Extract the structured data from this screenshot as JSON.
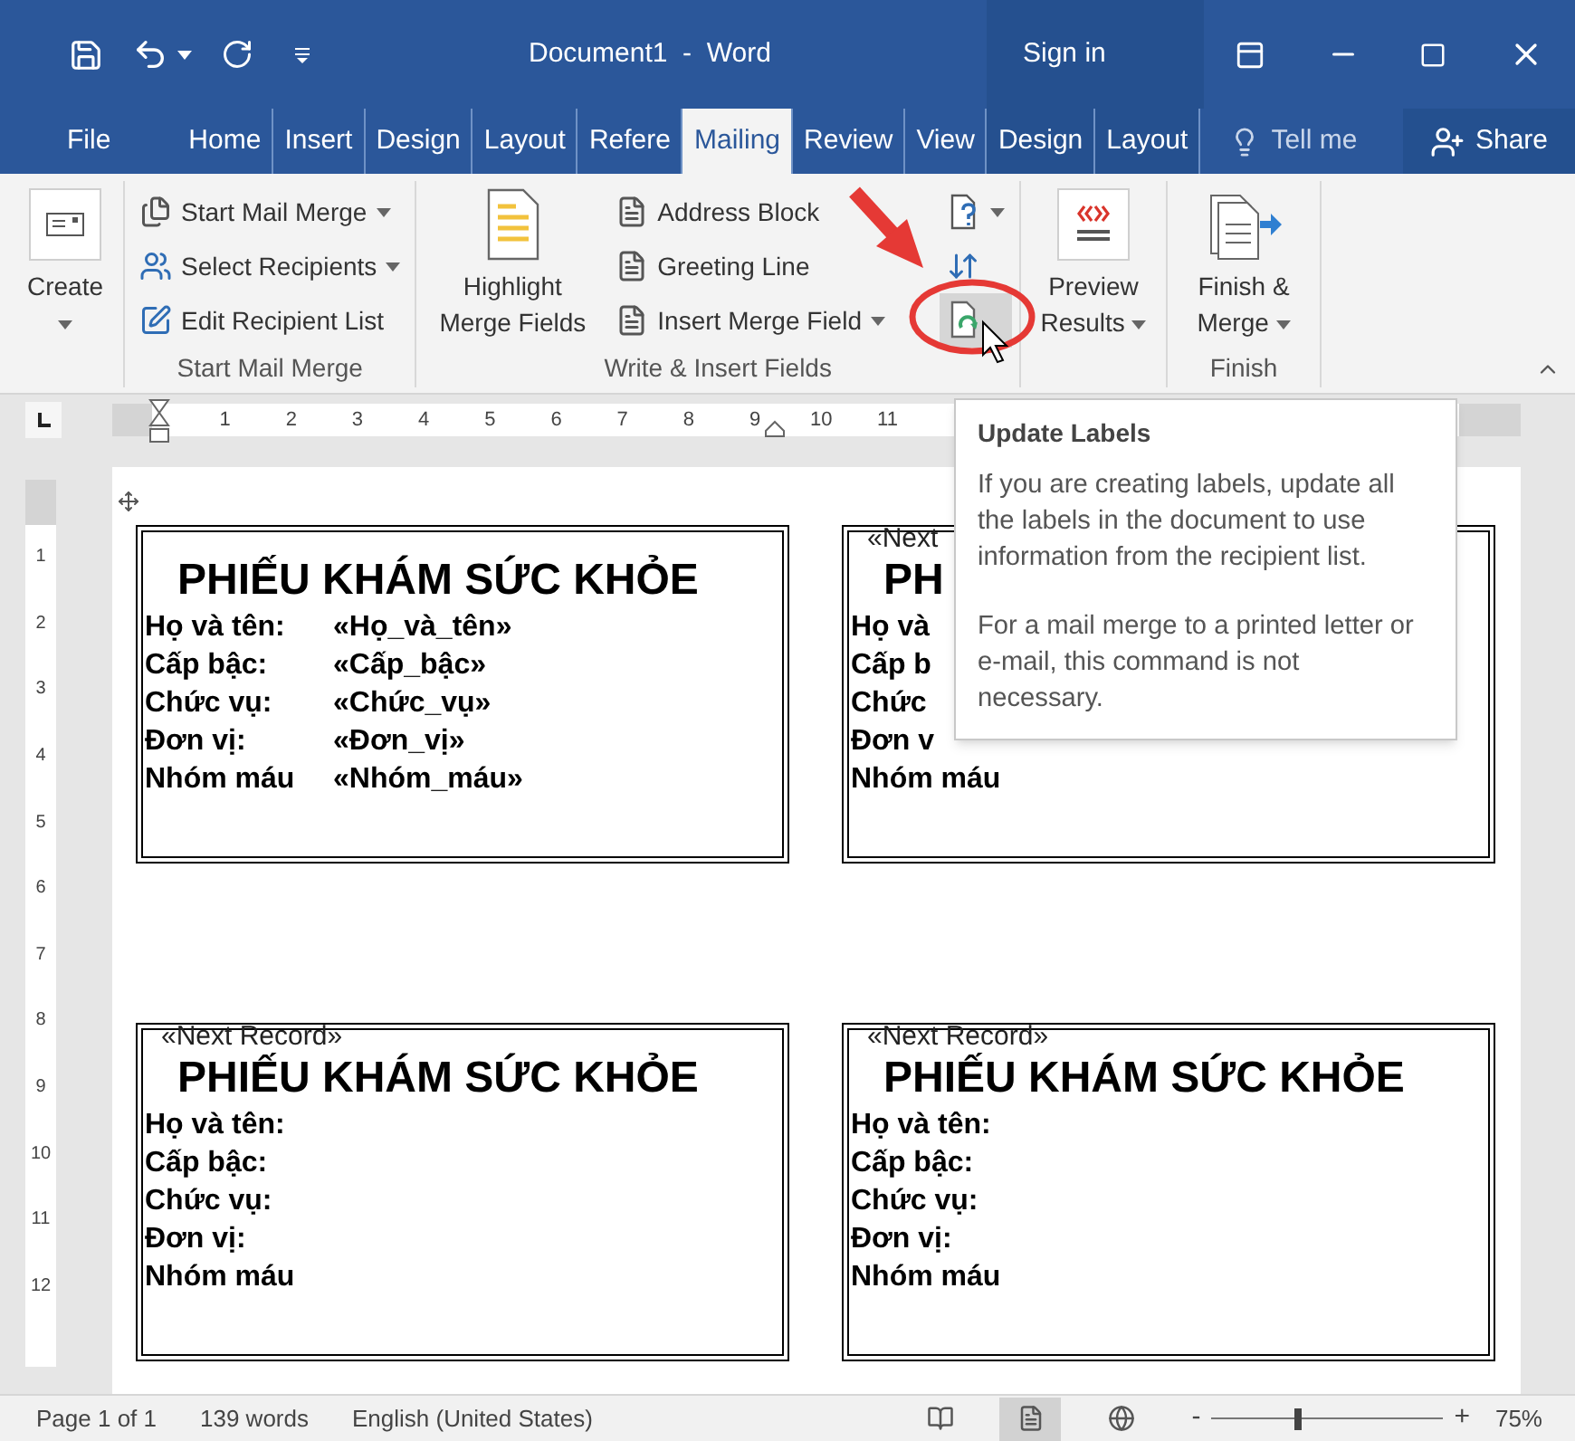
{
  "title_bar": {
    "title": "Document1  -  Word",
    "sign_in": "Sign in"
  },
  "tabs": [
    {
      "label": "File",
      "kind": "file",
      "selected": false
    },
    {
      "label": "Home",
      "kind": "main",
      "selected": false
    },
    {
      "label": "Insert",
      "kind": "main",
      "selected": false
    },
    {
      "label": "Design",
      "kind": "main",
      "selected": false
    },
    {
      "label": "Layout",
      "kind": "main",
      "selected": false
    },
    {
      "label": "Refere",
      "kind": "main",
      "selected": false
    },
    {
      "label": "Mailing",
      "kind": "main",
      "selected": true
    },
    {
      "label": "Review",
      "kind": "main",
      "selected": false
    },
    {
      "label": "View",
      "kind": "main",
      "selected": false
    },
    {
      "label": "Design",
      "kind": "contextual",
      "selected": false
    },
    {
      "label": "Layout",
      "kind": "contextual",
      "selected": false
    }
  ],
  "tell_me": "Tell me",
  "share": "Share",
  "ribbon": {
    "groups": [
      {
        "buttons": [
          {
            "label": "Create",
            "kind": "large",
            "dropdown": true,
            "hovered": false
          }
        ]
      },
      {
        "label": "Start Mail Merge",
        "buttons": [
          {
            "label": "Start Mail Merge",
            "kind": "small",
            "dropdown": true,
            "hovered": false
          },
          {
            "label": "Select Recipients",
            "kind": "small",
            "dropdown": true,
            "hovered": false
          },
          {
            "label": "Edit Recipient List",
            "kind": "small",
            "dropdown": false,
            "hovered": false
          }
        ]
      },
      {
        "label": "Write & Insert Fields",
        "buttons": [
          {
            "label": "Highlight Merge Fields",
            "kind": "large",
            "dropdown": false,
            "hovered": false
          },
          {
            "label": "Address Block",
            "kind": "small",
            "dropdown": false,
            "hovered": false
          },
          {
            "label": "Greeting Line",
            "kind": "small",
            "dropdown": false,
            "hovered": false
          },
          {
            "label": "Insert Merge Field",
            "kind": "small",
            "dropdown": true,
            "hovered": false
          },
          {
            "kind": "icon",
            "dropdown": true,
            "hovered": false
          },
          {
            "kind": "icon",
            "dropdown": false,
            "hovered": false
          },
          {
            "kind": "icon",
            "dropdown": false,
            "hovered": true
          }
        ]
      },
      {
        "buttons": [
          {
            "label": "Preview Results",
            "kind": "large",
            "dropdown": true,
            "hovered": false
          }
        ]
      },
      {
        "label": "Finish",
        "buttons": [
          {
            "label": "Finish & Merge",
            "kind": "large",
            "dropdown": true,
            "hovered": false
          }
        ]
      }
    ]
  },
  "ruler": {
    "numbers": [
      "1",
      "2",
      "3",
      "4",
      "5",
      "6",
      "7",
      "8",
      "9",
      "10",
      "11"
    ]
  },
  "vertical_ruler": {
    "numbers": [
      "1",
      "2",
      "3",
      "4",
      "5",
      "6",
      "7",
      "8",
      "9",
      "10",
      "11",
      "12"
    ]
  },
  "label_rows": [
    {
      "cards": [
        {
          "title": "PHIẾU KHÁM SỨC KHỎE",
          "rows": [
            {
              "label": "Họ và tên:",
              "field": "«Họ_và_tên»"
            },
            {
              "label": "Cấp bậc:",
              "field": "«Cấp_bậc»"
            },
            {
              "label": "Chức vụ:",
              "field": "«Chức_vụ»"
            },
            {
              "label": "Đơn vị:",
              "field": "«Đơn_vị»"
            },
            {
              "label": "Nhóm máu",
              "field": "«Nhóm_máu»"
            }
          ]
        },
        {
          "next_record": "«Next",
          "title": "PH",
          "rows": [
            {
              "label": "Họ và"
            },
            {
              "label": "Cấp b"
            },
            {
              "label": "Chức"
            },
            {
              "label": "Đơn v"
            },
            {
              "label": "Nhóm máu"
            }
          ]
        }
      ]
    },
    {
      "cards": [
        {
          "next_record": "«Next Record»",
          "title": "PHIẾU KHÁM SỨC KHỎE",
          "rows": [
            {
              "label": "Họ và tên:"
            },
            {
              "label": "Cấp bậc:"
            },
            {
              "label": "Chức vụ:"
            },
            {
              "label": "Đơn vị:"
            },
            {
              "label": "Nhóm máu"
            }
          ]
        },
        {
          "next_record": "«Next Record»",
          "title": "PHIẾU KHÁM SỨC KHỎE",
          "rows": [
            {
              "label": "Họ và tên:"
            },
            {
              "label": "Cấp bậc:"
            },
            {
              "label": "Chức vụ:"
            },
            {
              "label": "Đơn vị:"
            },
            {
              "label": "Nhóm máu"
            }
          ]
        }
      ]
    }
  ],
  "tooltip": {
    "title": "Update Labels",
    "paragraphs": [
      "If you are creating labels, update all the labels in the document to use information from the recipient list.",
      "For a mail merge to a printed letter or e-mail, this command is not necessary."
    ]
  },
  "status_bar": {
    "page": "Page 1 of 1",
    "words": "139 words",
    "language": "English (United States)",
    "views": [
      {
        "selected": false
      },
      {
        "selected": true
      },
      {
        "selected": false
      }
    ],
    "zoom_out": "-",
    "zoom_in": "+",
    "zoom": {
      "level": 0.37
    },
    "zoom_value": "75%"
  }
}
